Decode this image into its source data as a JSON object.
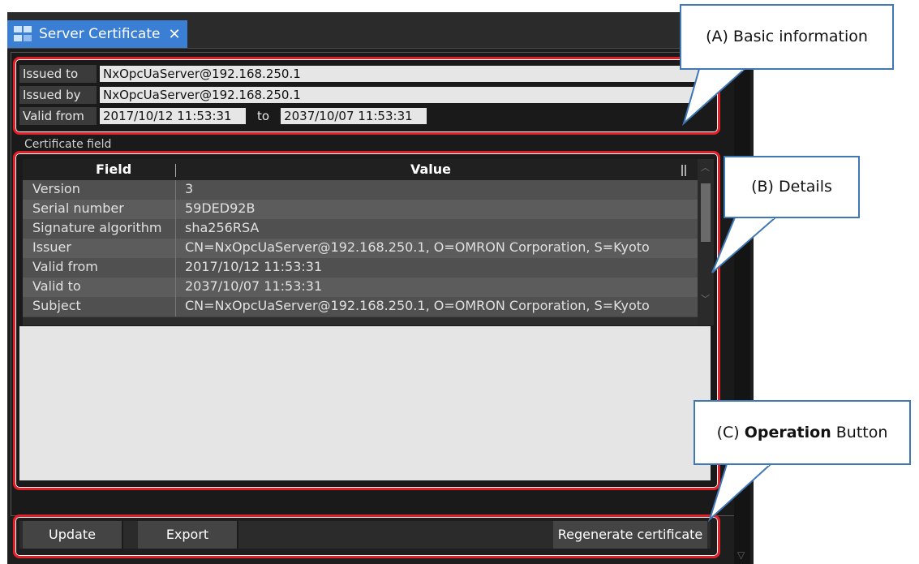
{
  "tab": {
    "title": "Server Certificate",
    "close_glyph": "✕",
    "icon": "server-certificate-icon"
  },
  "basic_info": {
    "issued_to_label": "Issued to",
    "issued_to_value": "NxOpcUaServer@192.168.250.1",
    "issued_by_label": "Issued by",
    "issued_by_value": "NxOpcUaServer@192.168.250.1",
    "valid_from_label": "Valid from",
    "valid_from_value": "2017/10/12 11:53:31",
    "to_label": "to",
    "valid_to_value": "2037/10/07 11:53:31"
  },
  "certificate_field": {
    "title": "Certificate field",
    "columns": [
      "Field",
      "Value"
    ],
    "rows": [
      {
        "field": "Version",
        "value": "3"
      },
      {
        "field": "Serial number",
        "value": "59DED92B"
      },
      {
        "field": "Signature algorithm",
        "value": "sha256RSA"
      },
      {
        "field": "Issuer",
        "value": "CN=NxOpcUaServer@192.168.250.1, O=OMRON Corporation, S=Kyoto"
      },
      {
        "field": "Valid from",
        "value": "2017/10/12 11:53:31"
      },
      {
        "field": "Valid to",
        "value": "2037/10/07 11:53:31"
      },
      {
        "field": "Subject",
        "value": "CN=NxOpcUaServer@192.168.250.1, O=OMRON Corporation, S=Kyoto"
      }
    ]
  },
  "buttons": {
    "update": "Update",
    "export": "Export",
    "regenerate": "Regenerate certificate"
  },
  "callouts": {
    "a": "(A) Basic information",
    "b": "(B) Details",
    "c_prefix": "(C) ",
    "c_bold": "Operation",
    "c_suffix": " Button"
  },
  "colors": {
    "accent": "#3a7fd3",
    "highlight": "#e21e26",
    "callout_border": "#3f78b5"
  }
}
